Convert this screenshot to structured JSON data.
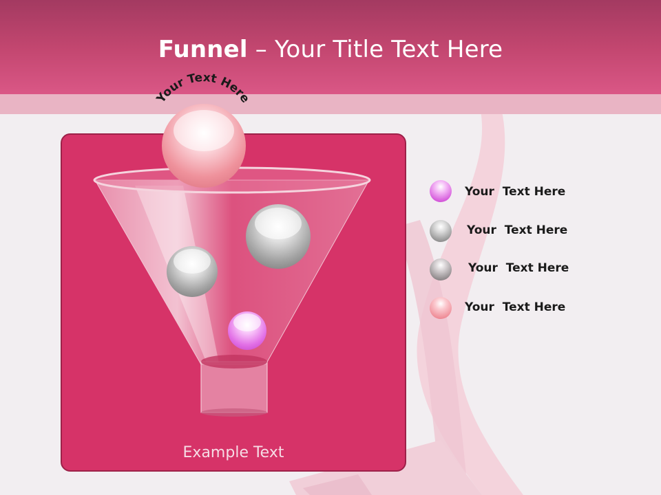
{
  "header": {
    "title_bold": "Funnel",
    "title_rest": " – Your Title Text Here"
  },
  "diagram": {
    "top_arc_text": "Your Text Here",
    "caption": "Example Text"
  },
  "legend": [
    {
      "label": "Your  Text Here",
      "color": "violet"
    },
    {
      "label": "Your  Text Here",
      "color": "gray"
    },
    {
      "label": "Your  Text Here",
      "color": "gray"
    },
    {
      "label": "Your  Text Here",
      "color": "pink"
    }
  ],
  "colors": {
    "header": "#c2466f",
    "panel": "#d63368",
    "panel_border": "#9d2149",
    "background": "#f2eef1"
  }
}
